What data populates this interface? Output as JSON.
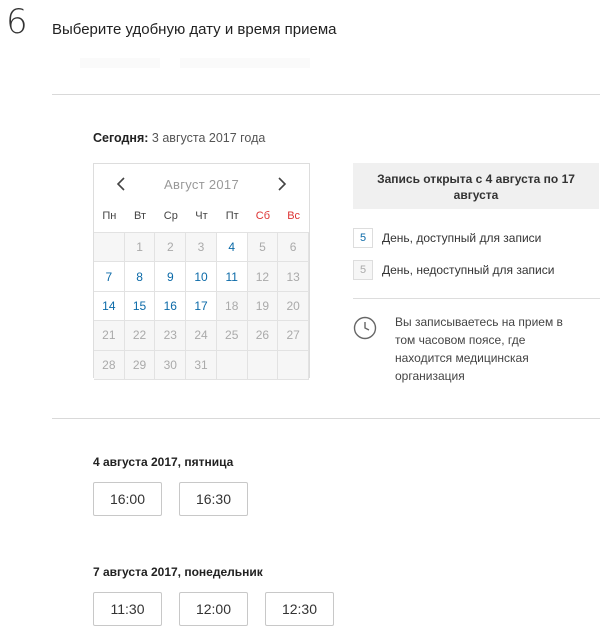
{
  "step": {
    "number": "6",
    "title": "Выберите удобную дату и время приема"
  },
  "today": {
    "label": "Сегодня:",
    "value": "3 августа 2017 года"
  },
  "calendar": {
    "month_label": "Август 2017",
    "weekdays": [
      "Пн",
      "Вт",
      "Ср",
      "Чт",
      "Пт",
      "Сб",
      "Вс"
    ],
    "weeks": [
      [
        null,
        {
          "d": "1",
          "s": "unavail"
        },
        {
          "d": "2",
          "s": "unavail"
        },
        {
          "d": "3",
          "s": "unavail"
        },
        {
          "d": "4",
          "s": "avail"
        },
        {
          "d": "5",
          "s": "unavail"
        },
        {
          "d": "6",
          "s": "unavail"
        }
      ],
      [
        {
          "d": "7",
          "s": "avail"
        },
        {
          "d": "8",
          "s": "avail"
        },
        {
          "d": "9",
          "s": "avail"
        },
        {
          "d": "10",
          "s": "avail"
        },
        {
          "d": "11",
          "s": "avail"
        },
        {
          "d": "12",
          "s": "unavail"
        },
        {
          "d": "13",
          "s": "unavail"
        }
      ],
      [
        {
          "d": "14",
          "s": "avail"
        },
        {
          "d": "15",
          "s": "avail"
        },
        {
          "d": "16",
          "s": "avail"
        },
        {
          "d": "17",
          "s": "avail"
        },
        {
          "d": "18",
          "s": "unavail"
        },
        {
          "d": "19",
          "s": "unavail"
        },
        {
          "d": "20",
          "s": "unavail"
        }
      ],
      [
        {
          "d": "21",
          "s": "unavail"
        },
        {
          "d": "22",
          "s": "unavail"
        },
        {
          "d": "23",
          "s": "unavail"
        },
        {
          "d": "24",
          "s": "unavail"
        },
        {
          "d": "25",
          "s": "unavail"
        },
        {
          "d": "26",
          "s": "unavail"
        },
        {
          "d": "27",
          "s": "unavail"
        }
      ],
      [
        {
          "d": "28",
          "s": "unavail"
        },
        {
          "d": "29",
          "s": "unavail"
        },
        {
          "d": "30",
          "s": "unavail"
        },
        {
          "d": "31",
          "s": "unavail"
        },
        null,
        null,
        null
      ]
    ]
  },
  "info": {
    "open_period": "Запись открыта с 4 августа по 17 августа",
    "legend_available": {
      "sample": "5",
      "text": "День, доступный для записи"
    },
    "legend_unavailable": {
      "sample": "5",
      "text": "День, недоступный для записи"
    },
    "timezone_note": "Вы записываетесь на прием в том часовом поясе, где находится медицинская организация",
    "timezone_icon": "clock-icon"
  },
  "slots": [
    {
      "date": "4 августа 2017, пятница",
      "times": [
        "16:00",
        "16:30"
      ]
    },
    {
      "date": "7 августа 2017, понедельник",
      "times": [
        "11:30",
        "12:00",
        "12:30"
      ]
    }
  ],
  "colors": {
    "available_day": "#0b6aa8",
    "weekend": "#dd3333",
    "unavailable_day": "#aaaaaa"
  }
}
